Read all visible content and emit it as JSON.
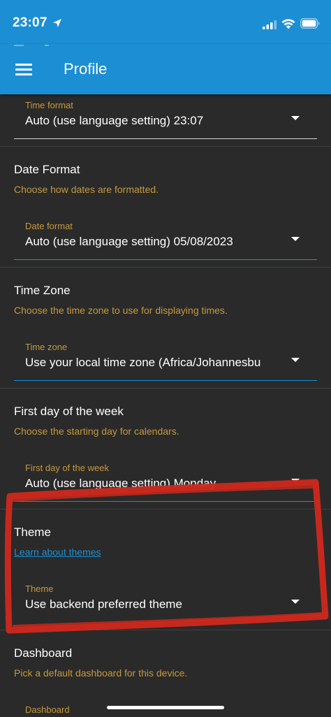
{
  "status_bar": {
    "time": "23:07",
    "icons": [
      "location-arrow-icon",
      "cellular-signal-icon",
      "wifi-icon",
      "battery-icon"
    ]
  },
  "app_bar": {
    "title": "Profile",
    "menu_icon": "hamburger-menu-icon"
  },
  "colors": {
    "primary": "#1c8ed3",
    "background": "#2a2a2a",
    "secondary_text": "#c59a3c",
    "annotation_red": "#d0281c"
  },
  "time_format": {
    "field_label": "Time format",
    "value": "Auto (use language setting) 23:07"
  },
  "date_format": {
    "title": "Date Format",
    "description": "Choose how dates are formatted.",
    "field_label": "Date format",
    "value": "Auto (use language setting) 05/08/2023"
  },
  "time_zone": {
    "title": "Time Zone",
    "description": "Choose the time zone to use for displaying times.",
    "field_label": "Time zone",
    "value": "Use your local time zone (Africa/Johannesbu"
  },
  "first_day": {
    "title": "First day of the week",
    "description": "Choose the starting day for calendars.",
    "field_label": "First day of the week",
    "value": "Auto (use language setting) Monday"
  },
  "theme": {
    "title": "Theme",
    "link": "Learn about themes",
    "field_label": "Theme",
    "value": "Use backend preferred theme"
  },
  "dashboard": {
    "title": "Dashboard",
    "description": "Pick a default dashboard for this device.",
    "field_label": "Dashboard"
  }
}
